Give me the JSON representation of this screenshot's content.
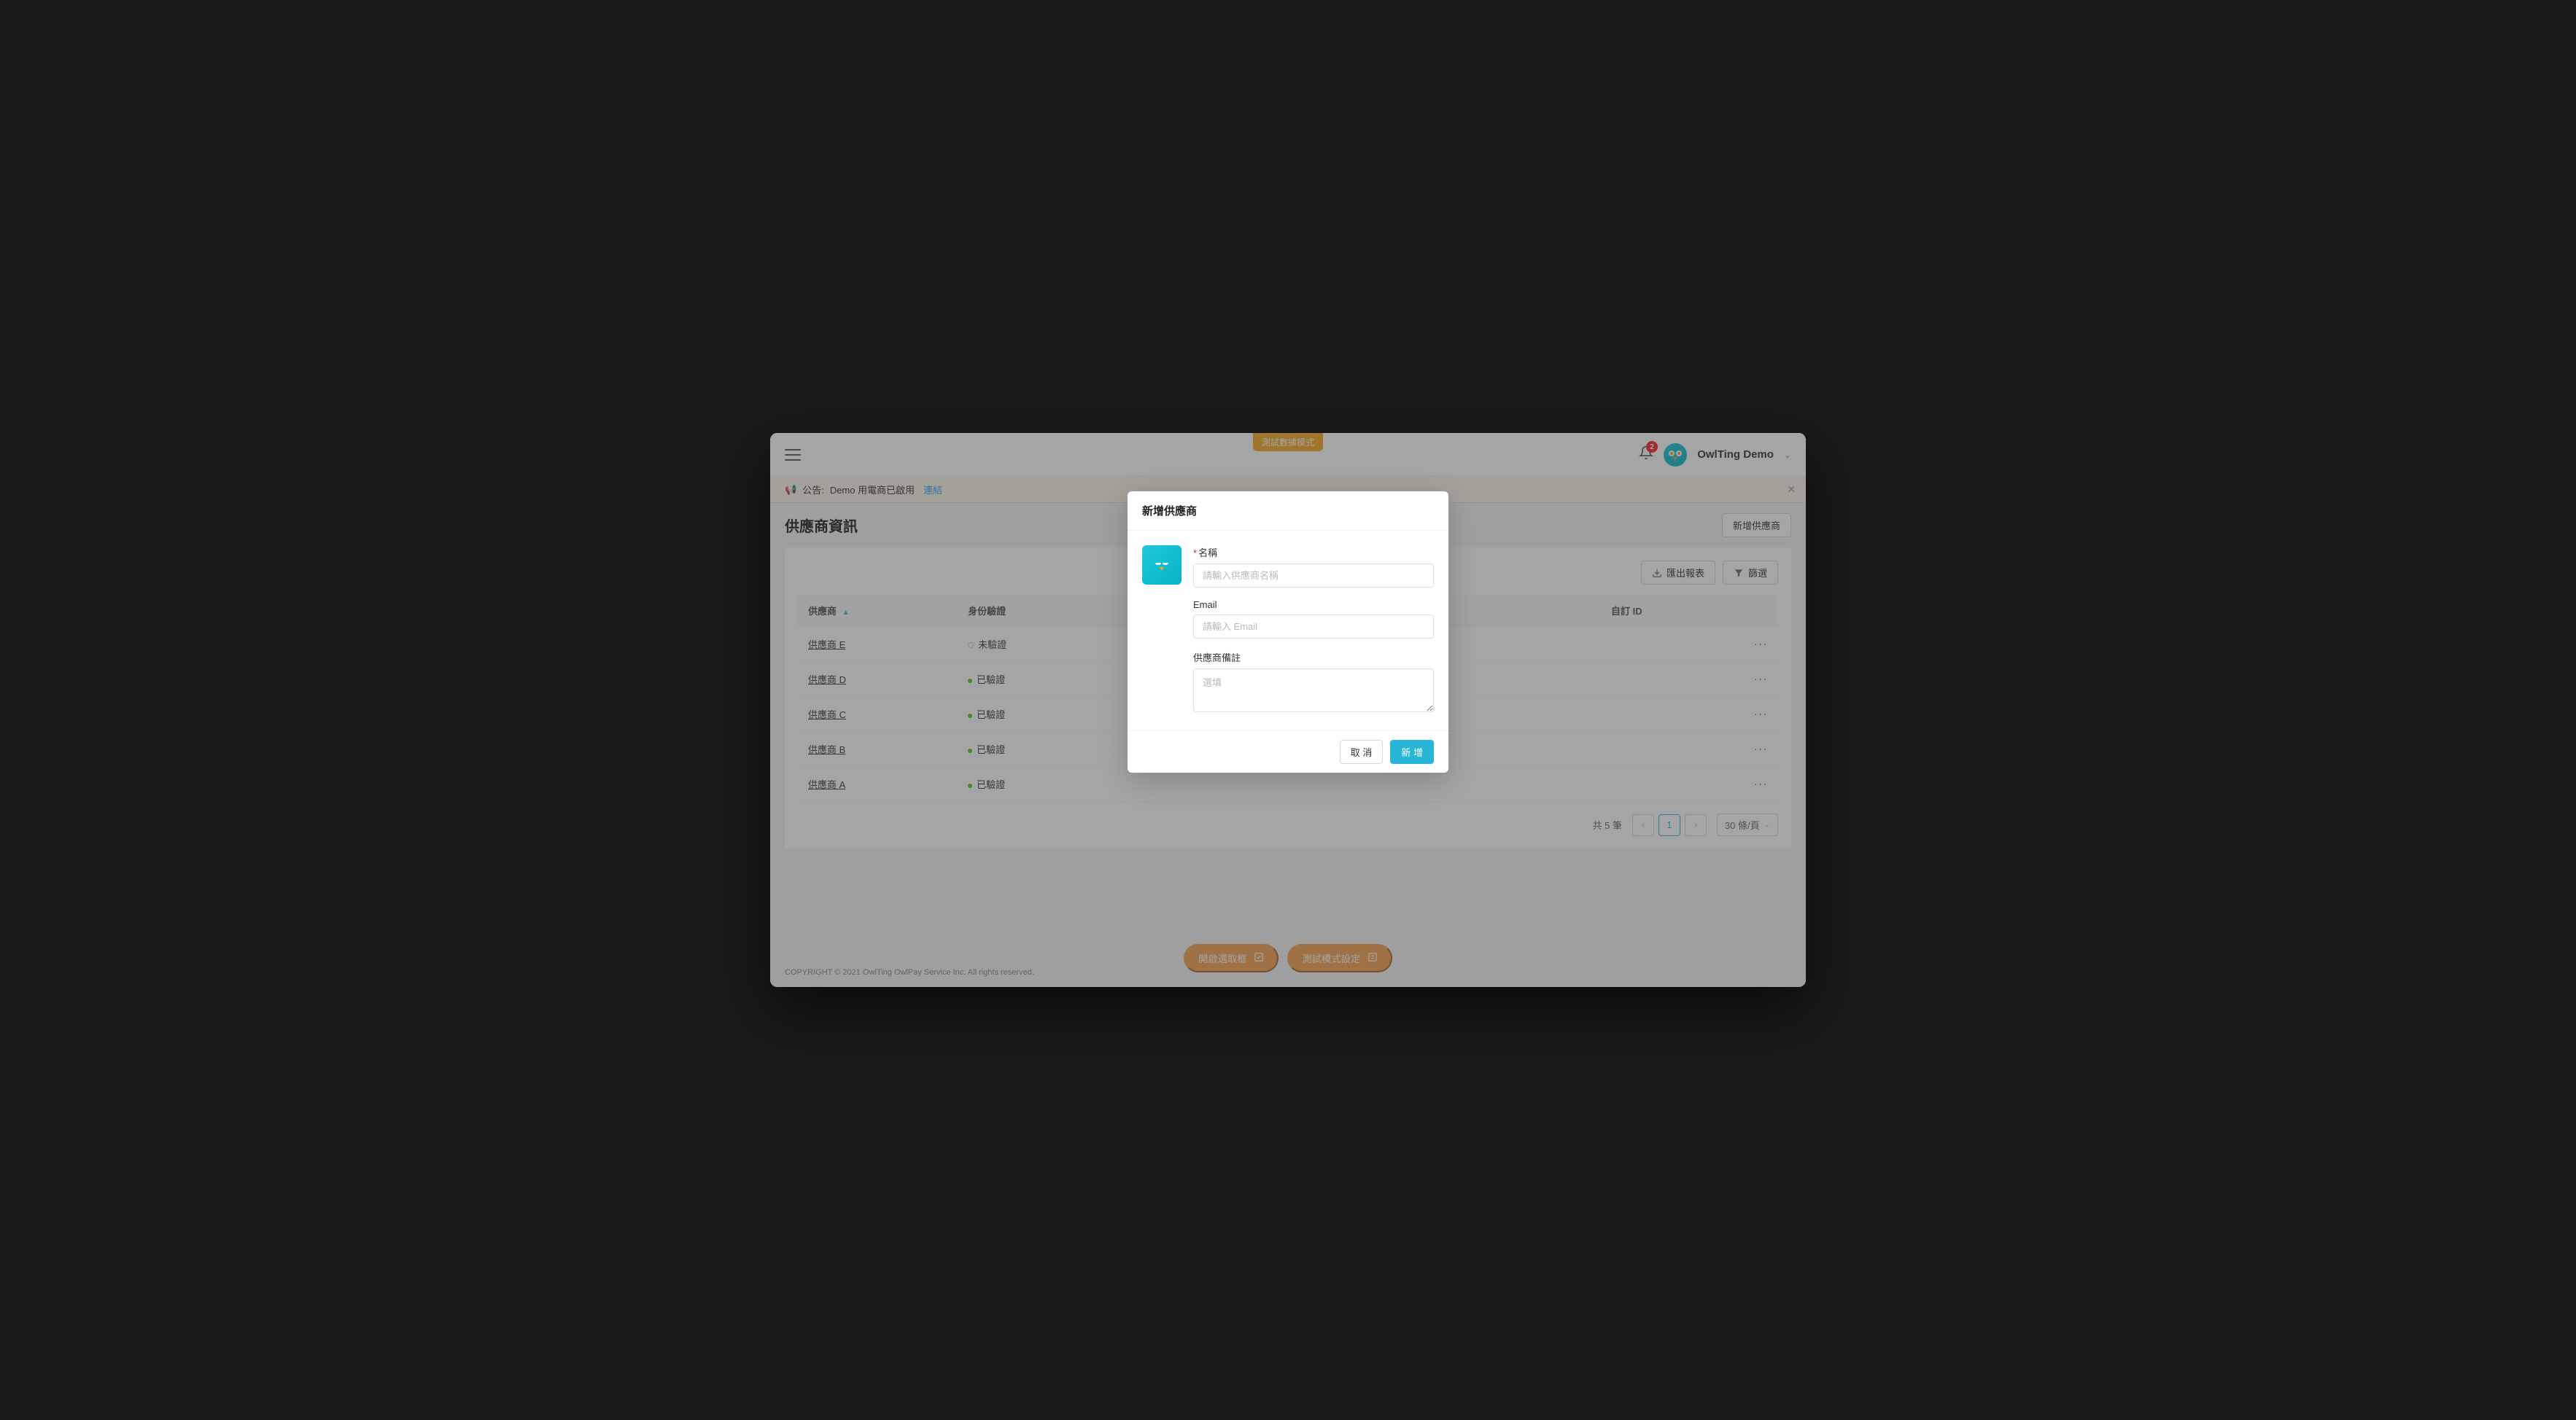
{
  "header": {
    "test_mode_tag": "測試數據模式",
    "notification_count": "2",
    "user_name": "OwlTing Demo"
  },
  "announcement": {
    "prefix": "公告:",
    "text": "Demo 用電商已啟用",
    "link_label": "連結"
  },
  "page": {
    "title": "供應商資訊",
    "add_button": "新增供應商"
  },
  "toolbar": {
    "export_label": "匯出報表",
    "filter_label": "篩選"
  },
  "table": {
    "columns": {
      "supplier": "供應商",
      "verification": "身份驗證",
      "custom_id": "自訂 ID"
    },
    "rows": [
      {
        "name": "供應商 E",
        "status_label": "未驗證",
        "status": "unverified",
        "custom_id": ""
      },
      {
        "name": "供應商 D",
        "status_label": "已驗證",
        "status": "verified",
        "custom_id": ""
      },
      {
        "name": "供應商 C",
        "status_label": "已驗證",
        "status": "verified",
        "custom_id": ""
      },
      {
        "name": "供應商 B",
        "status_label": "已驗證",
        "status": "verified",
        "custom_id": ""
      },
      {
        "name": "供應商 A",
        "status_label": "已驗證",
        "status": "verified",
        "custom_id": ""
      }
    ]
  },
  "pagination": {
    "total_label": "共 5 筆",
    "current_page": "1",
    "page_size_label": "30 條/頁"
  },
  "footer": {
    "copyright": "COPYRIGHT © 2021 OwlTing OwlPay Service Inc. All rights reserved."
  },
  "floating": {
    "open_selector": "開啟選取框",
    "test_mode_settings": "測試模式設定"
  },
  "modal": {
    "title": "新增供應商",
    "name_label": "名稱",
    "name_placeholder": "請輸入供應商名稱",
    "email_label": "Email",
    "email_placeholder": "請輸入 Email",
    "note_label": "供應商備註",
    "note_placeholder": "選填",
    "cancel_label": "取 消",
    "submit_label": "新 增"
  },
  "colors": {
    "accent": "#29b6d6",
    "orange": "#f5a04f",
    "success": "#52c41a",
    "danger": "#f5222d"
  }
}
